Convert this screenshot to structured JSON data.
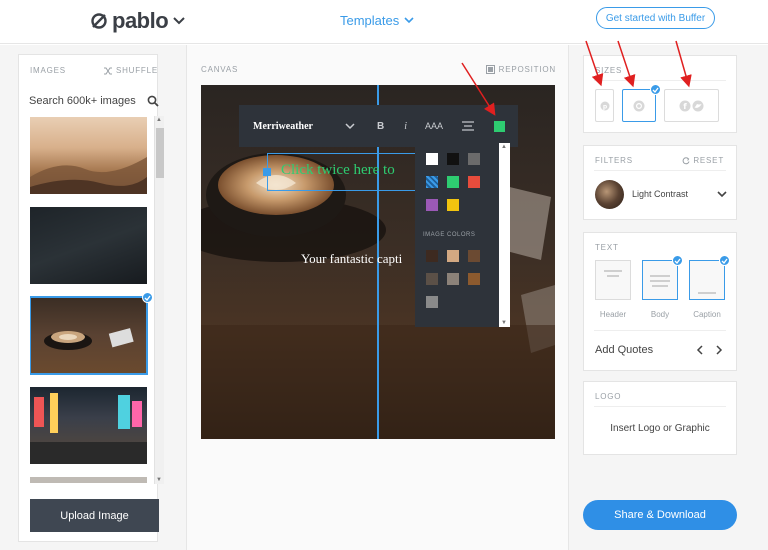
{
  "header": {
    "logo_text": "pablo",
    "templates_label": "Templates",
    "buffer_button": "Get started with Buffer"
  },
  "images_panel": {
    "title": "IMAGES",
    "shuffle_label": "SHUFFLE",
    "search_placeholder": "Search 600k+ images",
    "upload_label": "Upload Image",
    "thumbnails": [
      "misty-mountains",
      "night-sky",
      "coffee-table",
      "city-street",
      "partial-image"
    ],
    "selected_index": 2
  },
  "canvas_panel": {
    "title": "CANVAS",
    "reposition_label": "REPOSITION",
    "toolbar": {
      "font": "Merriweather",
      "bold": "B",
      "italic": "i",
      "size": "AAA",
      "align_icon": "align-center-icon",
      "color": "#2ecc71"
    },
    "headline_text": "Click twice here to",
    "caption_text": "Your fantastic capti",
    "palette": {
      "colors": [
        "#ffffff",
        "#111111",
        "#666666",
        "pattern",
        "#2ecc71",
        "#e74c3c",
        "#9b59b6",
        "#f1c40f"
      ],
      "image_colors_label": "IMAGE COLORS",
      "image_colors": [
        "#3d2a20",
        "#d2a882",
        "#6b4a32",
        "#5b5047",
        "#8c8279",
        "#8c5a2e",
        "#8a8a8a"
      ]
    }
  },
  "sizes_panel": {
    "title": "SIZES",
    "icons": [
      "pinterest-icon",
      "instagram-icon",
      "facebook-twitter-icon"
    ],
    "selected": "instagram"
  },
  "filters_panel": {
    "title": "FILTERS",
    "reset_label": "RESET",
    "selected_filter": "Light Contrast"
  },
  "text_panel": {
    "title": "TEXT",
    "cards": [
      "Header",
      "Body",
      "Caption"
    ],
    "selected": [
      "Body",
      "Caption"
    ],
    "add_quotes_label": "Add Quotes"
  },
  "logo_panel": {
    "title": "LOGO",
    "insert_label": "Insert Logo or Graphic"
  },
  "share_label": "Share & Download",
  "colors": {
    "accent": "#3a9be8",
    "dark": "#2e333a",
    "annotation": "#e02020"
  }
}
